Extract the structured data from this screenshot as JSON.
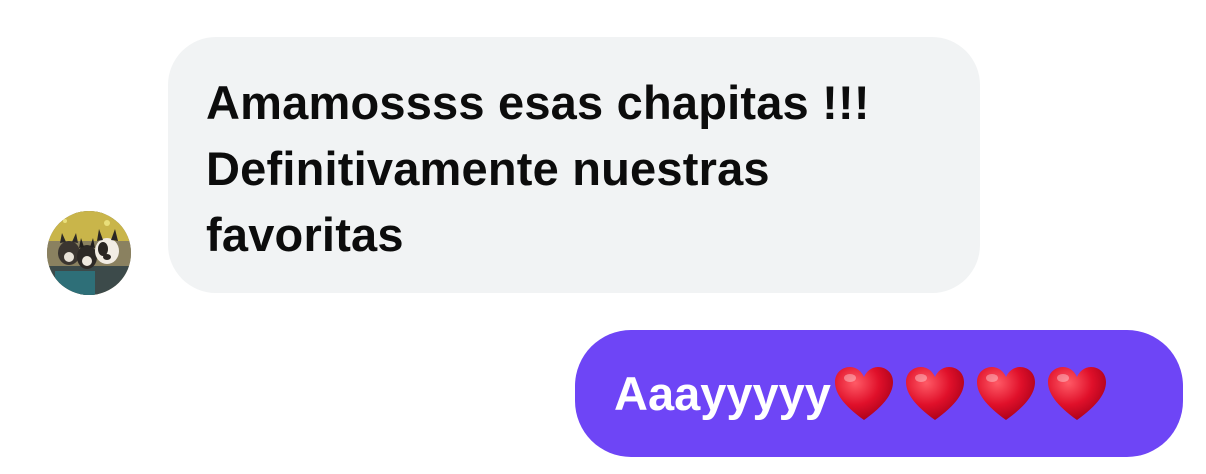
{
  "conversation": {
    "incoming": {
      "lines": [
        "Amamossss esas chapitas !!!",
        "Definitivamente nuestras",
        "favoritas"
      ]
    },
    "outgoing": {
      "text": "Aaayyyyy",
      "emoji": [
        "red-heart",
        "red-heart",
        "red-heart",
        "red-heart"
      ]
    }
  },
  "colors": {
    "incoming_bubble": "#f1f3f4",
    "outgoing_bubble": "#6e45f6",
    "heart": "#e0102a"
  }
}
